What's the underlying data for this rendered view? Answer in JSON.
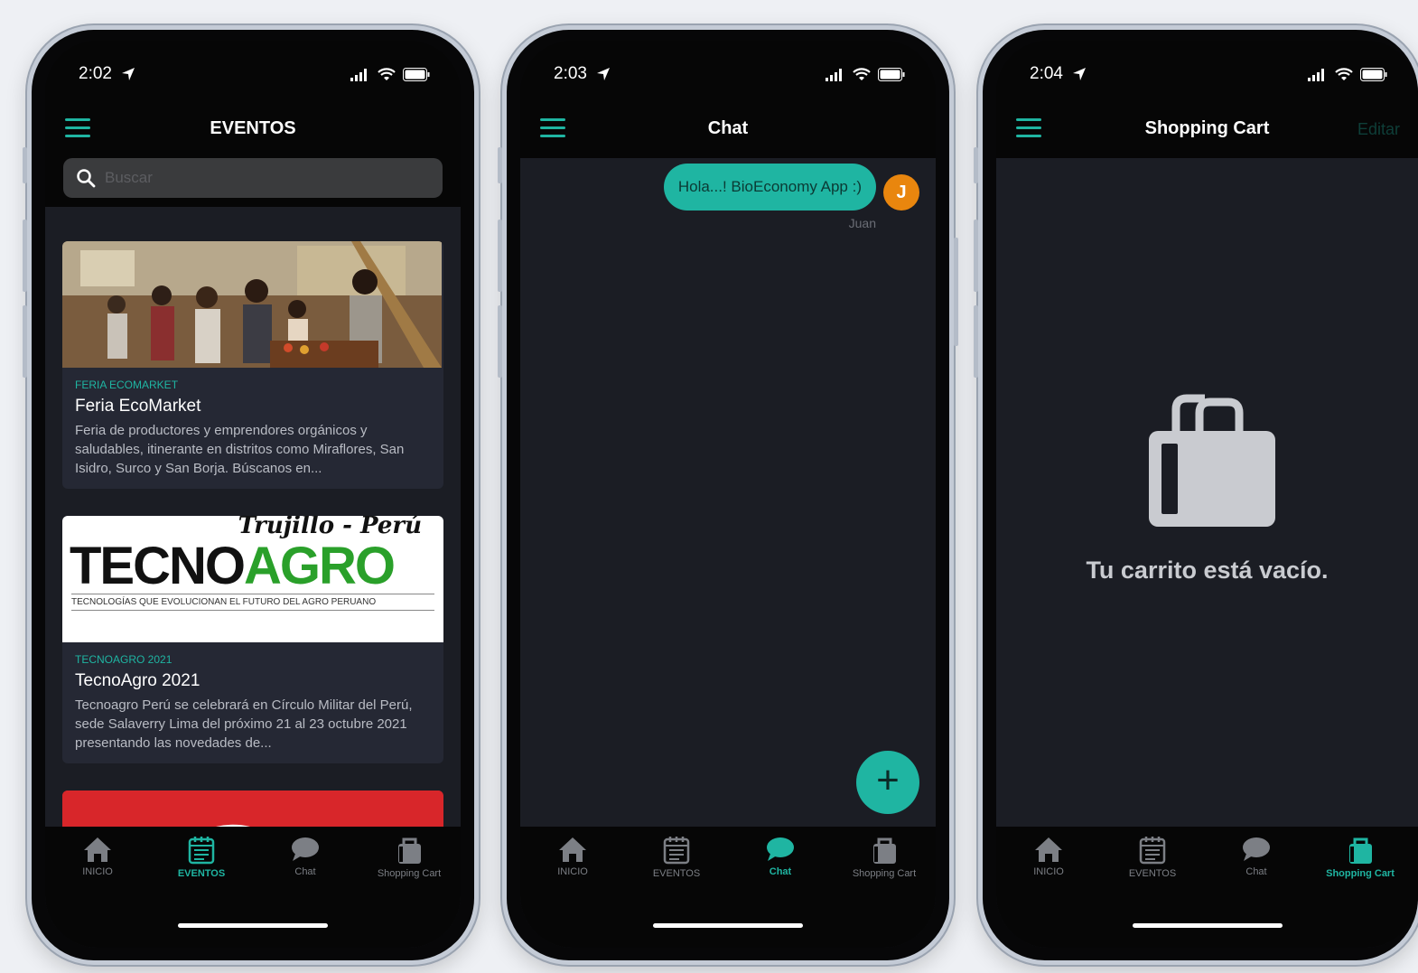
{
  "colors": {
    "accent": "#1fb5a2",
    "background": "#1b1d24",
    "card": "#252834",
    "avatar": "#e9860e"
  },
  "tabs": [
    "INICIO",
    "EVENTOS",
    "Chat",
    "Shopping Cart"
  ],
  "screens": [
    {
      "time": "2:02",
      "title": "EVENTOS",
      "search_placeholder": "Buscar",
      "events": [
        {
          "tag": "FERIA ECOMARKET",
          "title": "Feria EcoMarket",
          "description": "Feria de productores y emprendores orgánicos y saludables, itinerante en distritos como Miraflores, San Isidro, Surco y San Borja. Búscanos en..."
        },
        {
          "tag": "TECNOAGRO 2021",
          "title": "TecnoAgro 2021",
          "description": "Tecnoagro Perú se celebrará en Círculo Militar del Perú, sede Salaverry Lima del próximo 21 al 23 octubre 2021 presentando las novedades de...",
          "logo": {
            "script": "Trujillo - Perú",
            "word_a": "TECNO",
            "word_b": "AGRO",
            "tagline": "TECNOLOGÍAS QUE EVOLUCIONAN EL FUTURO DEL AGRO PERUANO"
          }
        }
      ],
      "active_tab": 1
    },
    {
      "time": "2:03",
      "title": "Chat",
      "message": {
        "text": "Hola...! BioEconomy App :)",
        "sender": "Juan",
        "avatar_letter": "J"
      },
      "fab_label": "+",
      "active_tab": 2
    },
    {
      "time": "2:04",
      "title": "Shopping Cart",
      "edit_label": "Editar",
      "empty_text": "Tu carrito está vacío.",
      "active_tab": 3
    }
  ]
}
